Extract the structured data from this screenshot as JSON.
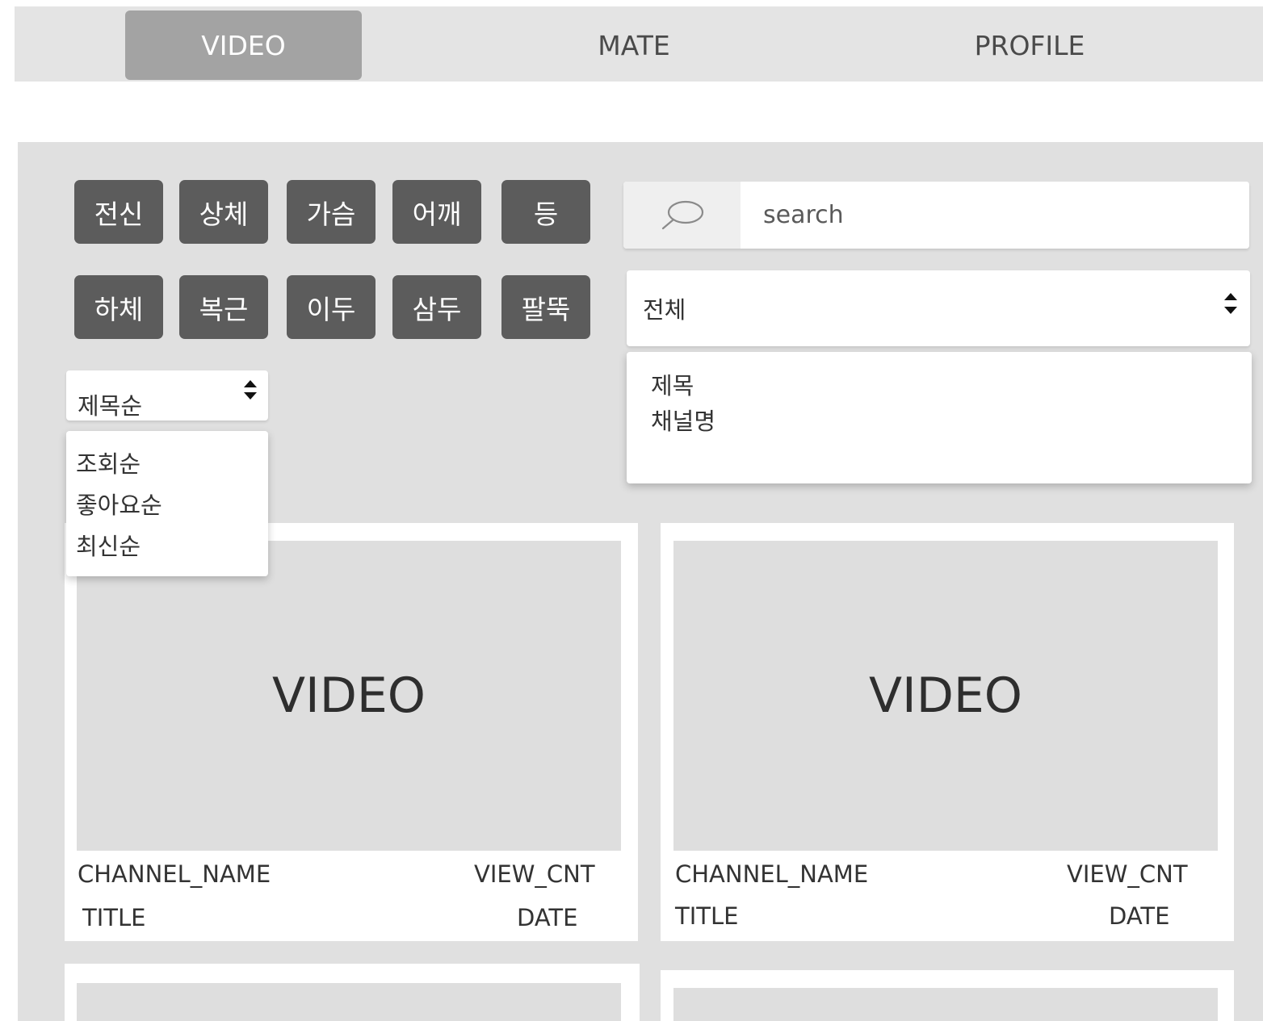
{
  "nav": {
    "tabs": [
      {
        "label": "VIDEO",
        "active": true
      },
      {
        "label": "MATE",
        "active": false
      },
      {
        "label": "PROFILE",
        "active": false
      }
    ]
  },
  "categories": [
    "전신",
    "상체",
    "가슴",
    "어깨",
    "등",
    "하체",
    "복근",
    "이두",
    "삼두",
    "팔뚝"
  ],
  "search": {
    "icon": "search-icon",
    "placeholder": "search"
  },
  "search_type": {
    "selected": "전체",
    "options": [
      "제목",
      "채널명"
    ]
  },
  "sort": {
    "selected": "제목순",
    "options": [
      "조회순",
      "좋아요순",
      "최신순"
    ]
  },
  "cards": [
    {
      "thumbnail": "VIDEO",
      "channel": "CHANNEL_NAME",
      "views": "VIEW_CNT",
      "title": "TITLE",
      "date": "DATE"
    },
    {
      "thumbnail": "VIDEO",
      "channel": "CHANNEL_NAME",
      "views": "VIEW_CNT",
      "title": "TITLE",
      "date": "DATE"
    }
  ],
  "colors": {
    "nav_bg": "#e4e4e4",
    "nav_active_bg": "#a3a3a3",
    "panel_bg": "#e0e0e0",
    "category_button_bg": "#5c5c5c",
    "thumbnail_bg": "#dedede"
  }
}
